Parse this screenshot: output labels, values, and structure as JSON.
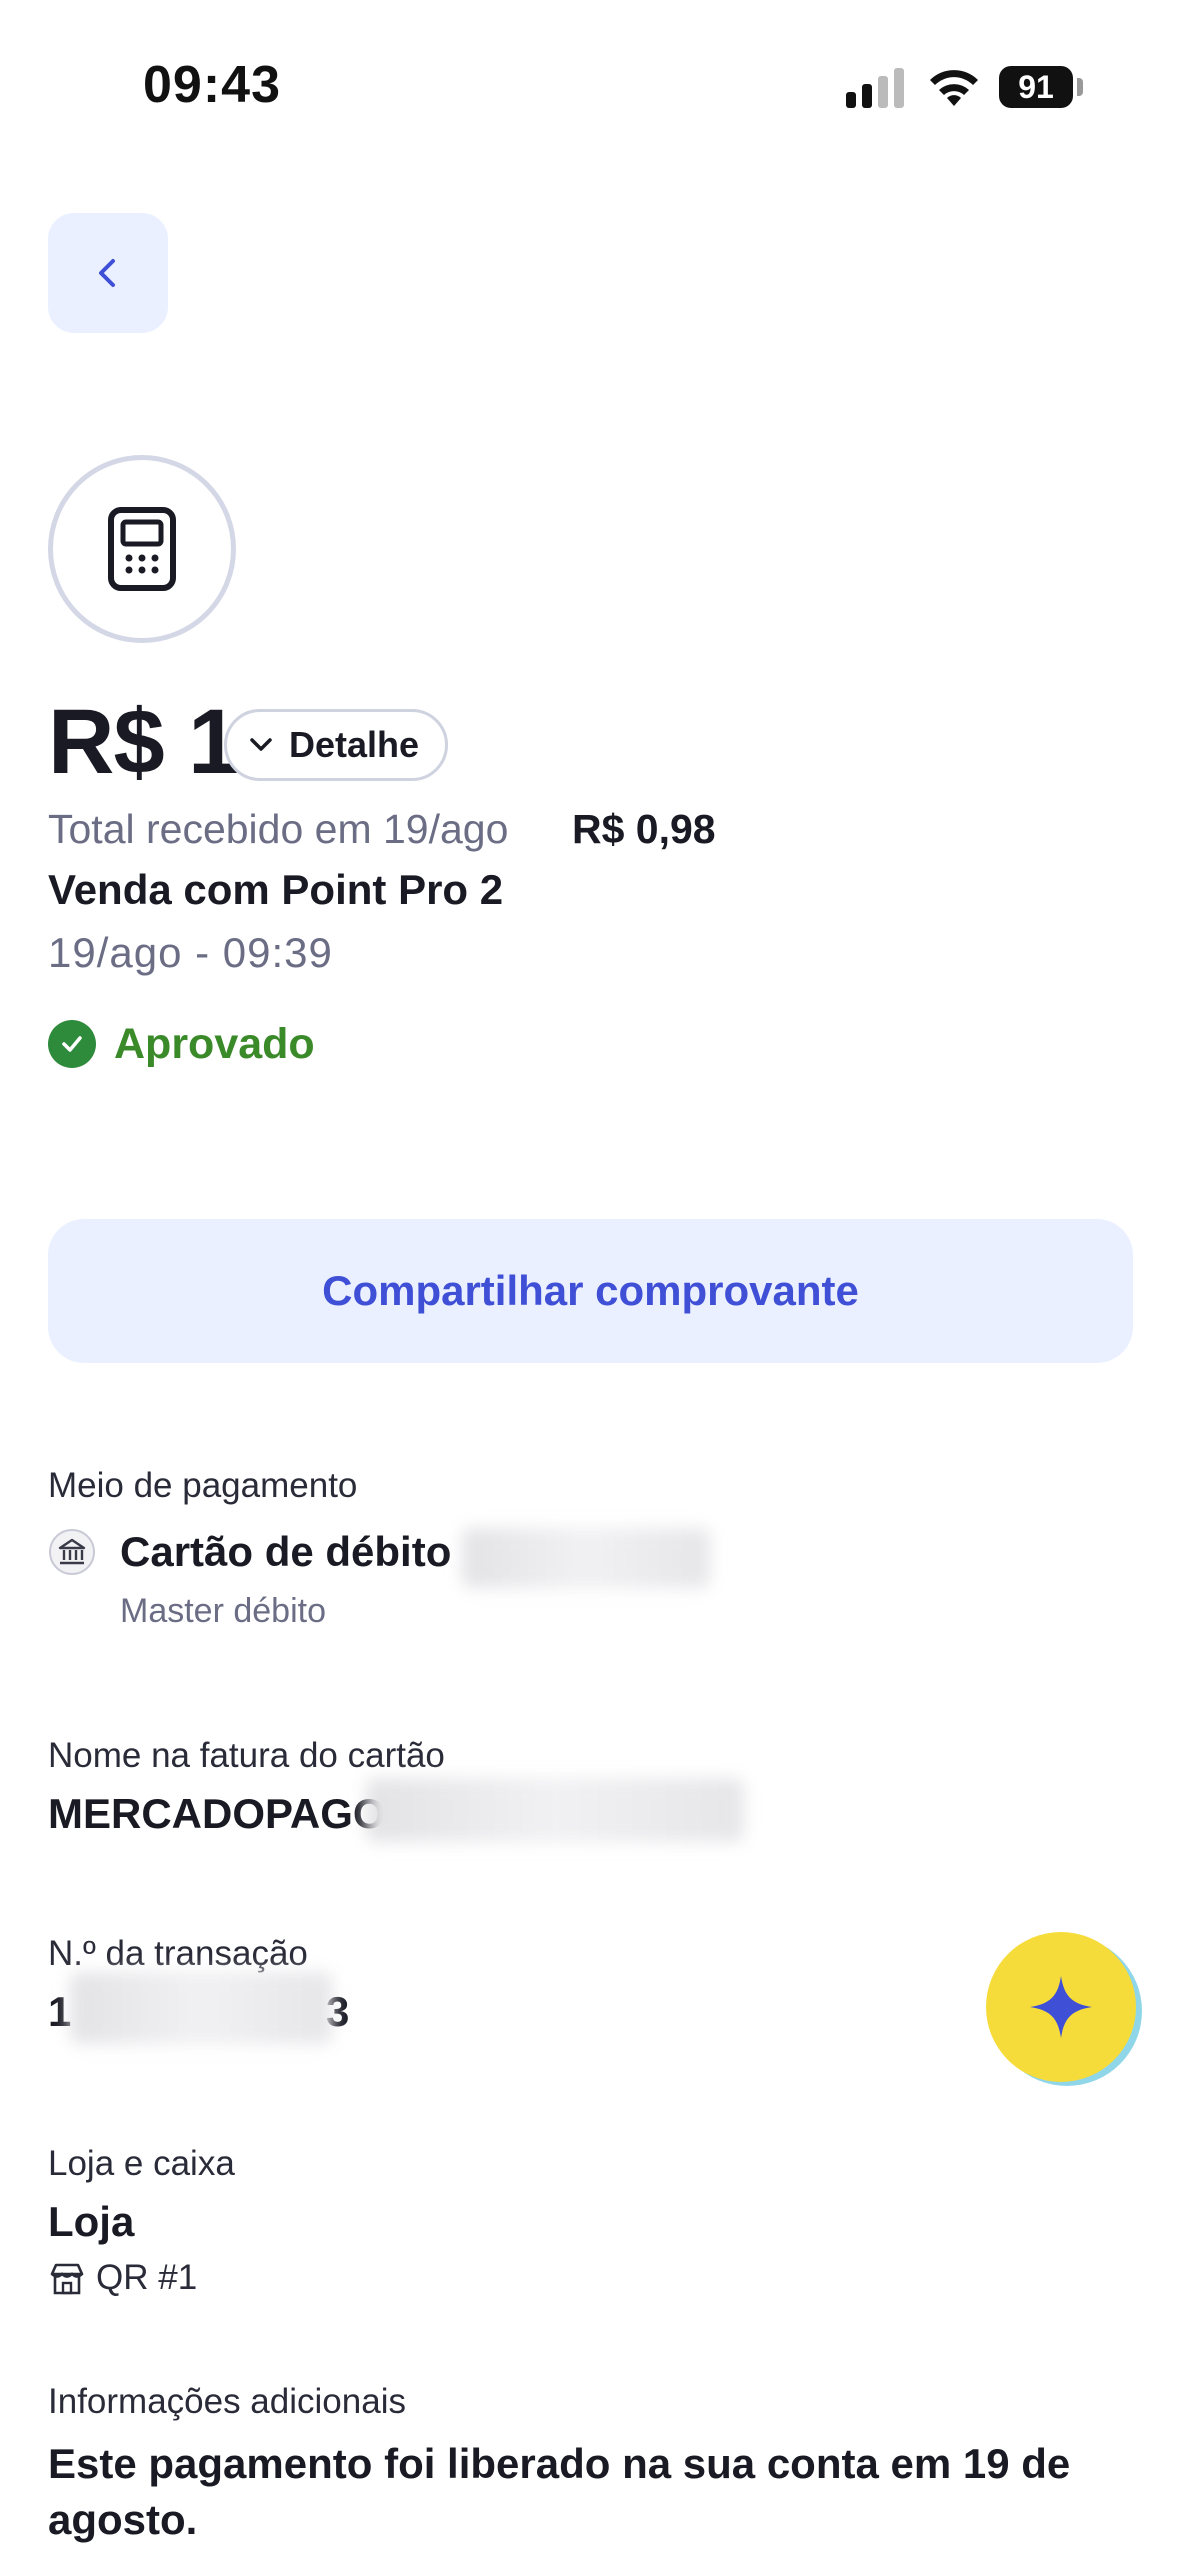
{
  "status_bar": {
    "time": "09:43",
    "battery": "91"
  },
  "header": {
    "back_icon": "chevron-left-icon"
  },
  "device": {
    "icon": "card-terminal-icon"
  },
  "transaction": {
    "amount": "R$ 1",
    "detail_label": "Detalhe",
    "received_label": "Total recebido em 19/ago",
    "received_value": "R$ 0,98",
    "title": "Venda com Point Pro 2",
    "datetime": "19/ago - 09:39",
    "status": "Aprovado"
  },
  "share": {
    "label": "Compartilhar comprovante"
  },
  "payment_method": {
    "label": "Meio de pagamento",
    "value": "Cartão de débito",
    "sub": "Master débito",
    "icon": "bank-icon"
  },
  "invoice_name": {
    "label": "Nome na fatura do cartão",
    "value": "MERCADOPAGO"
  },
  "transaction_number": {
    "label": "N.º da transação",
    "prefix": "1",
    "suffix": "3"
  },
  "store": {
    "label": "Loja e caixa",
    "value": "Loja",
    "register": "QR #1",
    "icon": "store-icon"
  },
  "additional_info": {
    "label": "Informações adicionais",
    "text": "Este pagamento foi liberado na sua conta em 19 de agosto."
  },
  "assistant": {
    "icon": "sparkle-icon"
  },
  "colors": {
    "accent": "#3f4fd6",
    "success": "#2e8b3c",
    "fab": "#f6dc3a"
  }
}
